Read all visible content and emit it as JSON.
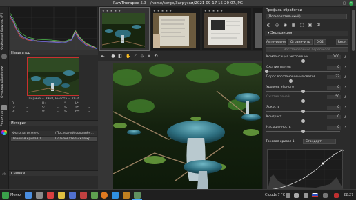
{
  "window": {
    "title": "RawTherapee 5.3 - /home/serge/Загрузки/2021-09-17 15-20-07.JPG"
  },
  "left_tabs": {
    "file_browser": "Файловый браузер (F2)",
    "queue": "Очередь обработки",
    "editor": "Редактор"
  },
  "navigator": {
    "header": "Навигатор",
    "size_text": "Ширина = 3968, Высота = 2976",
    "values_left": [
      "R:",
      "G:",
      "B:"
    ],
    "values_mid": [
      "H:",
      "S:",
      "V:"
    ],
    "values_right": [
      "L*:",
      "a*:",
      "b*:"
    ],
    "dashes": [
      "--",
      "--",
      "--"
    ],
    "deg": "°",
    "pct": "%"
  },
  "history": {
    "header": "История",
    "columns": [
      "Фото загружено",
      "(Последний сохранён..."
    ],
    "rows": [
      {
        "c1": "Тоновая кривая 1",
        "c2": "Пользовательская кр..."
      }
    ]
  },
  "snapshots": {
    "header": "Снимки",
    "zoom_level": "4%"
  },
  "filmstrip": {
    "stars": "★ ★ ★ ★ ★",
    "items": [
      "thumb-mushrooms",
      "thumb-document",
      "thumb-document-2",
      "thumb-dark"
    ]
  },
  "right_panel": {
    "header": "Профиль обработки",
    "profile_combo": "(Пользовательский)",
    "exposure_header": "Экспозиция",
    "auto_btn": "Автоуровни",
    "limit_btn": "Ограничить",
    "limit_val": "0.02",
    "reset_btn": "Reset",
    "recovery_label": "Восстановление пересветов",
    "sliders": [
      {
        "label": "Компенсация экспозиции",
        "value": "0.00",
        "level": 0.5
      },
      {
        "label": "Сжатие светов",
        "value": "0",
        "level": 0.0
      },
      {
        "label": "Порог восстановления светов",
        "value": "33",
        "level": 0.33
      },
      {
        "label": "Уровень чёрного",
        "value": "0",
        "level": 0.5
      },
      {
        "label": "Сжатие теней",
        "value": "50",
        "level": 0.5,
        "disabled": true
      },
      {
        "label": "Яркость",
        "value": "0",
        "level": 0.5
      },
      {
        "label": "Контраст",
        "value": "0",
        "level": 0.5
      },
      {
        "label": "Насыщенность",
        "value": "0",
        "level": 0.5
      }
    ],
    "curve_label": "Тоновая кривая 1",
    "curve_mode": "Стандарт"
  },
  "taskbar": {
    "menu": "Меню",
    "weather": "Clouds 7 °C",
    "clock": "22:27"
  },
  "colors": {
    "accent": "#2aa84a",
    "nav_frame": "#c83030",
    "taskbar_active": "#4aa8ff"
  }
}
